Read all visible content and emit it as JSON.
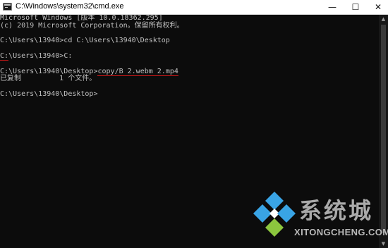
{
  "window": {
    "title": "C:\\Windows\\system32\\cmd.exe",
    "minimize_glyph": "—",
    "maximize_glyph": "☐",
    "close_glyph": "✕"
  },
  "console": {
    "lines": [
      "Microsoft Windows [版本 10.0.18362.295]",
      "(c) 2019 Microsoft Corporation。保留所有权利。",
      "",
      "C:\\Users\\13940>cd C:\\Users\\13940\\Desktop",
      "",
      "C:\\Users\\13940>C:",
      "",
      "C:\\Users\\13940\\Desktop>copy/B 2.webm 2.mp4",
      "已复制         1 个文件。",
      "",
      "C:\\Users\\13940\\Desktop>"
    ],
    "highlights": [
      {
        "line": 5,
        "text": "C:"
      },
      {
        "line": 7,
        "text": "copy/B 2.webm 2.mp4"
      }
    ]
  },
  "scrollbar": {
    "up_glyph": "▲",
    "down_glyph": "▼"
  },
  "watermark": {
    "cn_text": "系统城",
    "en_text": "XITONGCHENG.COM",
    "colors": [
      "#39a4e5",
      "#8cc63e",
      "#ffffff"
    ]
  },
  "colors": {
    "background": "#0c0c0c",
    "text": "#c0c0c0",
    "underline": "#d01818"
  }
}
